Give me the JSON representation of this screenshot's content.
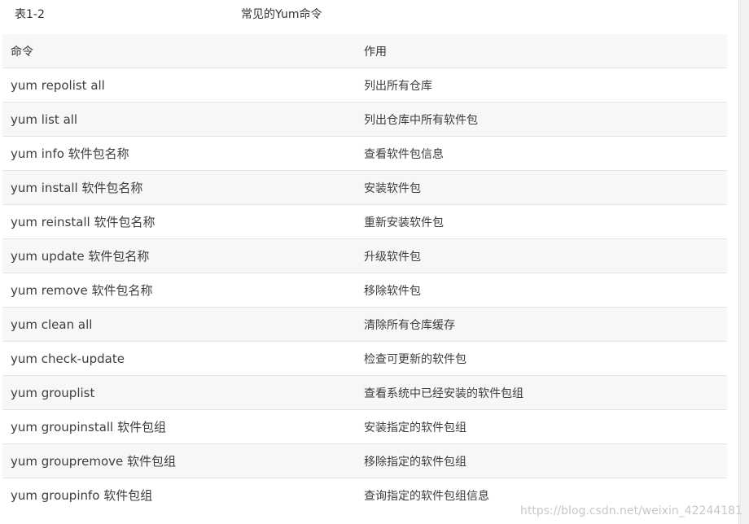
{
  "caption": {
    "number": "表1-2",
    "title": "常见的Yum命令"
  },
  "table": {
    "headers": [
      "命令",
      "作用"
    ],
    "rows": [
      [
        "yum repolist all",
        "列出所有仓库"
      ],
      [
        "yum list all",
        "列出仓库中所有软件包"
      ],
      [
        "yum info 软件包名称",
        "查看软件包信息"
      ],
      [
        "yum install 软件包名称",
        "安装软件包"
      ],
      [
        "yum reinstall 软件包名称",
        "重新安装软件包"
      ],
      [
        "yum update 软件包名称",
        "升级软件包"
      ],
      [
        "yum remove 软件包名称",
        "移除软件包"
      ],
      [
        "yum clean all",
        "清除所有仓库缓存"
      ],
      [
        "yum check-update",
        "检查可更新的软件包"
      ],
      [
        "yum grouplist",
        "查看系统中已经安装的软件包组"
      ],
      [
        "yum groupinstall 软件包组",
        "安装指定的软件包组"
      ],
      [
        "yum groupremove 软件包组",
        "移除指定的软件包组"
      ],
      [
        "yum groupinfo 软件包组",
        "查询指定的软件包组信息"
      ]
    ]
  },
  "watermark": "https://blog.csdn.net/weixin_42244181"
}
